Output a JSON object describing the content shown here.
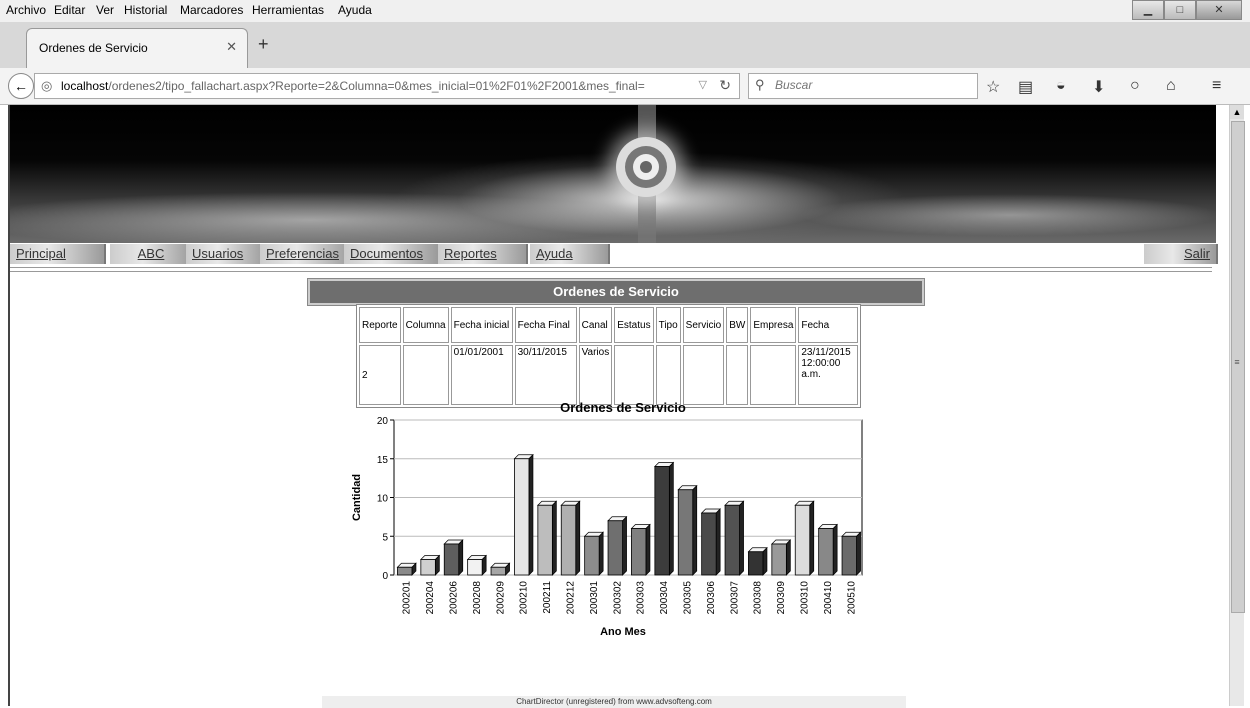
{
  "menu": [
    "Archivo",
    "Editar",
    "Ver",
    "Historial",
    "Marcadores",
    "Herramientas",
    "Ayuda"
  ],
  "tab": {
    "title": "Ordenes de Servicio"
  },
  "address": {
    "host": "localhost",
    "path": "/ordenes2/tipo_fallachart.aspx?Reporte=2&Columna=0&mes_inicial=01%2F01%2F2001&mes_final="
  },
  "search": {
    "placeholder": "Buscar"
  },
  "nav": {
    "items": [
      "Principal",
      "ABC",
      "Usuarios",
      "Preferencias",
      "Documentos",
      "Reportes",
      "Ayuda"
    ],
    "logout": "Salir"
  },
  "page": {
    "title": "Ordenes de Servicio",
    "footer": "ChartDirector (unregistered) from www.advsofteng.com"
  },
  "table": {
    "headers": [
      "Reporte",
      "Columna",
      "Fecha inicial",
      "Fecha Final",
      "Canal",
      "Estatus",
      "Tipo",
      "Servicio",
      "BW",
      "Empresa",
      "Fecha"
    ],
    "row": [
      "2",
      "",
      "01/01/2001",
      "30/11/2015",
      "Varios",
      "",
      "",
      "",
      "",
      "",
      "23/11/2015 12:00:00 a.m."
    ]
  },
  "chart_data": {
    "type": "bar",
    "title": "Ordenes de Servicio",
    "xlabel": "Ano Mes",
    "ylabel": "Cantidad",
    "ylim": [
      0,
      20
    ],
    "yticks": [
      0,
      5,
      10,
      15,
      20
    ],
    "grid": true,
    "categories": [
      "200201",
      "200204",
      "200206",
      "200208",
      "200209",
      "200210",
      "200211",
      "200212",
      "200301",
      "200302",
      "200303",
      "200304",
      "200305",
      "200306",
      "200307",
      "200308",
      "200309",
      "200310",
      "200410",
      "200510"
    ],
    "values": [
      1,
      2,
      4,
      2,
      1,
      15,
      9,
      9,
      5,
      7,
      6,
      14,
      11,
      8,
      9,
      3,
      4,
      9,
      6,
      5
    ],
    "colors": [
      "#8a8a8a",
      "#d0d0d0",
      "#5e5e5e",
      "#f2f2f2",
      "#a6a6a6",
      "#e6e6e6",
      "#bdbdbd",
      "#b0b0b0",
      "#8c8c8c",
      "#6f6f6f",
      "#808080",
      "#3c3c3c",
      "#777777",
      "#4a4a4a",
      "#525252",
      "#333333",
      "#9a9a9a",
      "#dcdcdc",
      "#888888",
      "#6a6a6a"
    ]
  }
}
